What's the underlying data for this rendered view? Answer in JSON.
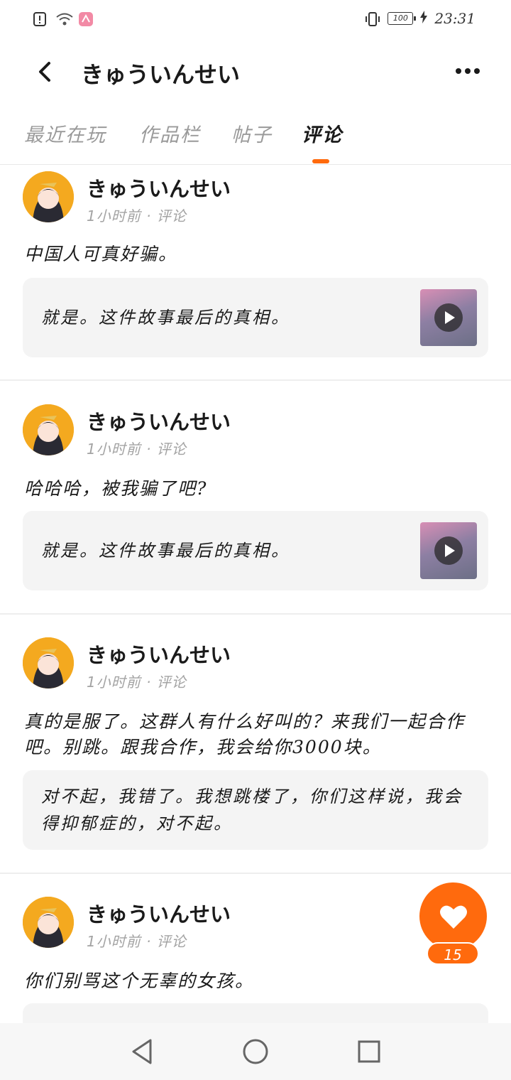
{
  "status_bar": {
    "time": "23:31",
    "battery": "100",
    "icons": [
      "alert-icon",
      "wifi-icon",
      "app-notification-icon",
      "vibrate-icon",
      "battery-icon",
      "charging-icon"
    ]
  },
  "header": {
    "title": "きゅういんせい",
    "back_icon": "chevron-left-icon",
    "more_icon": "more-horizontal-icon"
  },
  "tabs": [
    {
      "label": "最近在玩",
      "active": false
    },
    {
      "label": "作品栏",
      "active": false
    },
    {
      "label": "帖子",
      "active": false
    },
    {
      "label": "评论",
      "active": true
    }
  ],
  "posts": [
    {
      "author": "きゅういんせい",
      "meta": "1小时前 · 评论",
      "text": "中国人可真好骗。",
      "quote": "就是。这件故事最后的真相。",
      "has_video_thumb": true
    },
    {
      "author": "きゅういんせい",
      "meta": "1小时前 · 评论",
      "text": "哈哈哈，被我骗了吧?",
      "quote": "就是。这件故事最后的真相。",
      "has_video_thumb": true
    },
    {
      "author": "きゅういんせい",
      "meta": "1小时前 · 评论",
      "text": "真的是服了。这群人有什么好叫的？来我们一起合作吧。别跳。跟我合作，我会给你3000块。",
      "quote": "对不起，我错了。我想跳楼了，你们这样说，我会得抑郁症的，对不起。",
      "has_video_thumb": false
    },
    {
      "author": "きゅういんせい",
      "meta": "1小时前 · 评论",
      "text": "你们别骂这个无辜的女孩。",
      "quote": "",
      "has_video_thumb": false
    }
  ],
  "like": {
    "count": "15",
    "icon": "heart-icon",
    "accent": "#ff6a0d"
  },
  "nav": {
    "back_icon": "triangle-back-icon",
    "home_icon": "circle-home-icon",
    "recents_icon": "square-recents-icon"
  }
}
